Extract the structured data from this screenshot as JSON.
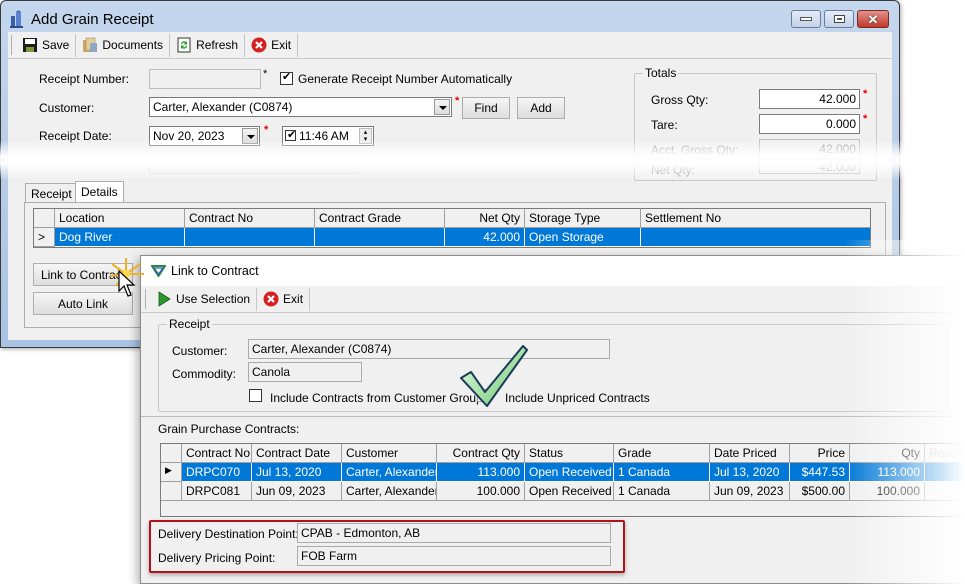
{
  "main_window": {
    "title": "Add Grain Receipt",
    "title_icon": "silo-icon",
    "window_controls": [
      "minimize",
      "maximize",
      "close"
    ],
    "toolbar": [
      {
        "label": "Save",
        "icon": "floppy-disk-icon"
      },
      {
        "label": "Documents",
        "icon": "documents-icon"
      },
      {
        "label": "Refresh",
        "icon": "refresh-icon"
      },
      {
        "label": "Exit",
        "icon": "exit-icon"
      }
    ],
    "form": {
      "receipt_number_label": "Receipt Number:",
      "receipt_number_value": "",
      "receipt_number_marker": "*",
      "generate_auto_label": "Generate Receipt Number Automatically",
      "generate_auto_checked": true,
      "customer_label": "Customer:",
      "customer_value": "Carter, Alexander (C0874)",
      "required_marker": "*",
      "find_label": "Find",
      "add_label": "Add",
      "receipt_date_label": "Receipt Date:",
      "receipt_date_value": "Nov 20, 2023",
      "receipt_time_value": "11:46 AM",
      "receipt_time_checked": true
    },
    "totals": {
      "title": "Totals",
      "gross_qty_label": "Gross Qty:",
      "gross_qty_value": "42.000",
      "tare_label": "Tare:",
      "tare_value": "0.000",
      "acct_gross_label": "Acct. Gross Qty:",
      "acct_gross_value": "42.000",
      "net_qty_label": "Net Qty:",
      "net_qty_value": "42.000"
    },
    "tabs": [
      {
        "label": "Receipt",
        "active": false
      },
      {
        "label": "Details",
        "active": true
      }
    ],
    "details_grid": {
      "columns": [
        "Location",
        "Contract No",
        "Contract Grade",
        "Net Qty",
        "Storage Type",
        "Settlement No"
      ],
      "rows": [
        {
          "indicator": ">",
          "cells": [
            "Dog River",
            "",
            "",
            "42.000",
            "Open Storage",
            ""
          ],
          "selected": true
        }
      ]
    },
    "link_to_contract_label": "Link to Contract",
    "auto_link_label": "Auto Link"
  },
  "link_dialog": {
    "title": "Link to Contract",
    "toolbar": [
      {
        "label": "Use Selection",
        "icon": "play-icon"
      },
      {
        "label": "Exit",
        "icon": "exit-icon"
      }
    ],
    "receipt_group": {
      "title": "Receipt",
      "customer_label": "Customer:",
      "customer_value": "Carter, Alexander (C0874)",
      "commodity_label": "Commodity:",
      "commodity_value": "Canola",
      "include_group_label": "Include Contracts from Customer Group",
      "include_group_checked": false,
      "include_unpriced_label": "Include Unpriced Contracts",
      "include_unpriced_checked": true
    },
    "contracts_label": "Grain Purchase Contracts:",
    "contracts_grid": {
      "columns": [
        "Contract No",
        "Contract Date",
        "Customer",
        "Contract Qty",
        "Status",
        "Grade",
        "Date Priced",
        "Price",
        "Qty",
        "Receiv"
      ],
      "rows": [
        {
          "indicator": "▶",
          "selected": true,
          "cells": [
            "DRPC070",
            "Jul 13, 2020",
            "Carter, Alexander",
            "113.000",
            "Open Received",
            "1 Canada",
            "Jul 13, 2020",
            "$447.53",
            "113.000",
            ""
          ]
        },
        {
          "indicator": "",
          "selected": false,
          "cells": [
            "DRPC081",
            "Jun 09, 2023",
            "Carter, Alexander",
            "100.000",
            "Open Received",
            "1 Canada",
            "Jun 09, 2023",
            "$500.00",
            "100.000",
            ""
          ]
        }
      ]
    },
    "delivery_destination_label": "Delivery Destination Point:",
    "delivery_destination_value": "CPAB - Edmonton, AB",
    "delivery_pricing_label": "Delivery Pricing Point:",
    "delivery_pricing_value": "FOB Farm"
  },
  "colors": {
    "selection": "#0078d7",
    "required": "#e00000",
    "highlight_box": "#b0121b",
    "titlebar": "#b8cfea"
  }
}
